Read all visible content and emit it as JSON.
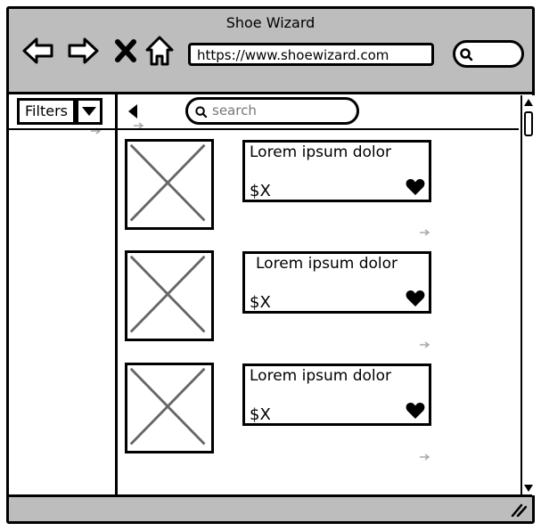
{
  "window": {
    "title": "Shoe Wizard"
  },
  "browser": {
    "url": "https://www.shoewizard.com",
    "icons": [
      "back-arrow-icon",
      "forward-arrow-icon",
      "stop-icon",
      "home-icon",
      "search-icon"
    ]
  },
  "sidebar": {
    "filters_label": "Filters"
  },
  "main": {
    "search_placeholder": "search"
  },
  "products": [
    {
      "name": "Lorem ipsum dolor",
      "price": "$X"
    },
    {
      "name": "Lorem ipsum dolor",
      "price": "$X"
    },
    {
      "name": "Lorem ipsum dolor",
      "price": "$X"
    }
  ],
  "colors": {
    "chrome": "#bdbdbd",
    "stroke": "#000000",
    "placeholder_x": "#666666"
  }
}
